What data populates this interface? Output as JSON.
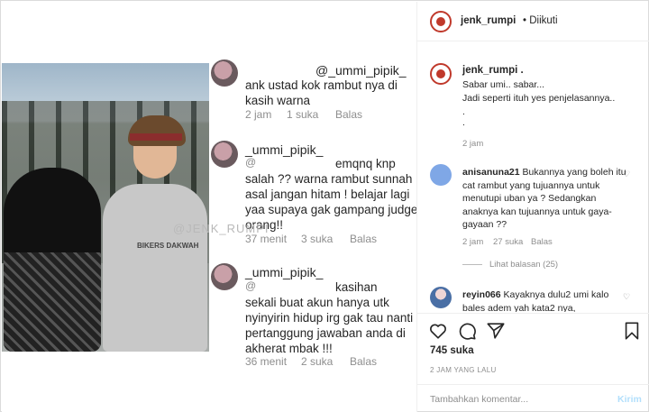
{
  "post": {
    "image": {
      "watermark": "@JENK_RUMPI",
      "hoodie_text": "BIKERS DAKWAH",
      "screenshot_comments": [
        {
          "username": "",
          "mention": "@_ummi_pipik_",
          "lines": [
            "ank ustad kok rambut nya di",
            "kasih warna"
          ],
          "time": "2 jam",
          "likes": "1 suka",
          "reply": "Balas"
        },
        {
          "username": "_ummi_pipik_",
          "mention": "@",
          "lines": [
            "emqnq knp",
            "salah ?? warna rambut sunnah",
            "asal jangan hitam ! belajar lagi",
            "yaa supaya gak gampang judge",
            "orang!!"
          ],
          "time": "37 menit",
          "likes": "3 suka",
          "reply": "Balas"
        },
        {
          "username": "_ummi_pipik_",
          "mention": "@",
          "lines": [
            "kasihan",
            "sekali buat akun hanya utk",
            "nyinyirin hidup irg gak tau nanti",
            "pertanggung jawaban anda di",
            "akherat mbak !!!"
          ],
          "time": "36 menit",
          "likes": "2 suka",
          "reply": "Balas"
        }
      ]
    },
    "header": {
      "username": "jenk_rumpi",
      "follow_status": "• Diikuti"
    },
    "caption": {
      "username": "jenk_rumpi .",
      "lines": [
        "Sabar umi.. sabar...",
        "Jadi seperti ituh yes penjelasannya..",
        ".",
        "."
      ],
      "time": "2 jam"
    },
    "comments": [
      {
        "username": "anisanuna21",
        "text": "Bukannya yang boleh itu cat rambut yang tujuannya untuk menutupi uban ya ? Sedangkan anaknya kan tujuannya untuk gaya-gayaan ??",
        "time": "2 jam",
        "likes": "27 suka",
        "reply": "Balas",
        "view_replies": "Lihat balasan (25)",
        "avatar_color": "#7fa7e6"
      },
      {
        "username": "reyin066",
        "text": "Kayaknya dulu2 umi kalo bales adem yah kata2 nya,",
        "avatar_color": "#4a6fa5"
      }
    ],
    "likes": "745 suka",
    "time_ago": "2 JAM YANG LALU",
    "add_comment_placeholder": "Tambahkan komentar...",
    "send_label": "Kirim"
  },
  "colors": {
    "accent": "#0095f6",
    "send_disabled": "#b2dffc",
    "muted": "#8e8e8e",
    "logo": "#c0392b"
  }
}
